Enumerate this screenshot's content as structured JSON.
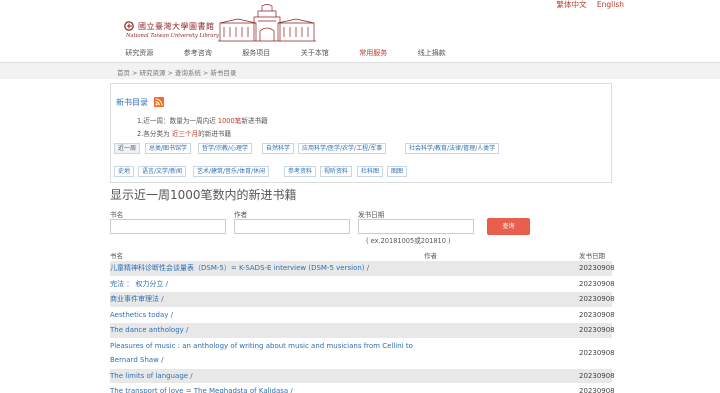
{
  "header": {
    "lang_tc": "繁体中文",
    "lang_en": "English",
    "logo_cn": "國立臺灣大學圖書館",
    "logo_en": "National Taiwan University Library"
  },
  "nav": [
    "研究资源",
    "参考咨询",
    "服务项目",
    "关于本馆",
    "常用服务",
    "线上捐款"
  ],
  "breadcrumb": [
    "首页",
    "研究资源",
    "查询系统",
    "新书目录"
  ],
  "panel": {
    "title": "新书目录",
    "note1_pre": "1.近一周：数量为一周内近 ",
    "note1_hl": "1000笔",
    "note1_post": "新进书籍",
    "note2_pre": "2.各分类为 ",
    "note2_hl": "近三个月",
    "note2_post": "的新进书籍"
  },
  "categories_row1": [
    "近一周",
    "总类/图书馆学",
    "哲学/宗教/心理学",
    "自然科学",
    "应用科学/医学/农学/工程/军事",
    "社会科学/教育/法律/管理/人类学"
  ],
  "categories_row2": [
    "史地",
    "语言/文学/新闻",
    "艺术/建筑/音乐/体育/休闲",
    "参考资料",
    "视听资料",
    "杜科图",
    "图图"
  ],
  "heading": "显示近一周1000笔数内的新进书籍",
  "form": {
    "title_label": "书名",
    "author_label": "作者",
    "date_label": "发书日期",
    "search_label": "查询",
    "hint": "( ex.20181005或201810 )"
  },
  "table": {
    "headers": [
      "书名",
      "作者",
      "发书日期"
    ],
    "rows": [
      {
        "title": "儿童精神科诊断性会谈量表（DSM-5）= K-SADS-E interview (DSM-5 version) /",
        "date": "20230908"
      },
      {
        "title": "完法 ： 权力分立 /",
        "date": "20230908"
      },
      {
        "title": "商业事件审理法 /",
        "date": "20230908"
      },
      {
        "title": "Aesthetics today /",
        "date": "20230908"
      },
      {
        "title": "The dance anthology /",
        "date": "20230908"
      },
      {
        "title": "Pleasures of music : an anthology of writing about music and musicians from Cellini to Bernard Shaw /",
        "date": "20230908"
      },
      {
        "title": "The limits of language /",
        "date": "20230908"
      },
      {
        "title": "The transport of love = The Meghadsta of Kalidasa /",
        "date": "20230908"
      }
    ]
  },
  "colors": {
    "accent": "#c0392b",
    "link": "#2f6fb4",
    "button": "#e8604c",
    "rss": "#f26c26"
  }
}
